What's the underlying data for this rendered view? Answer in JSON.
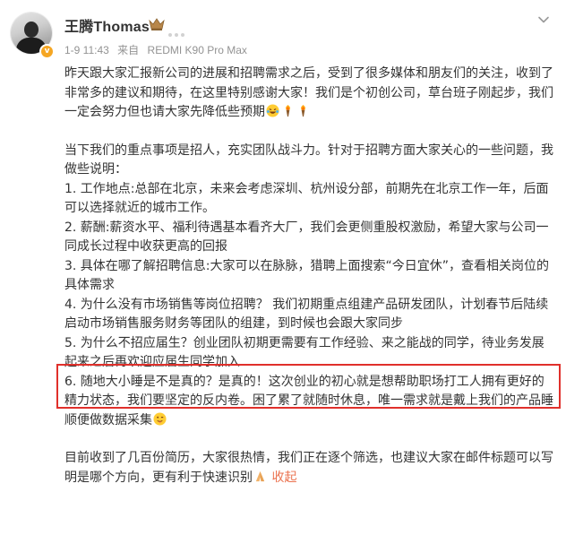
{
  "author": {
    "name": "王腾Thomas",
    "avatar_icon": "avatar-photo",
    "verified_icon": "verified-v-icon",
    "crown_icon": "crown-icon"
  },
  "meta": {
    "date": "1-9 11:43",
    "source_prefix": "来自",
    "device": "REDMI K90 Pro Max"
  },
  "actions": {
    "more_icon": "chevron-down-icon"
  },
  "post": {
    "para1": "昨天跟大家汇报新公司的进展和招聘需求之后，受到了很多媒体和朋友们的关注，收到了非常多的建议和期待，在这里特别感谢大家！我们是个初创公司，草台班子刚起步，我们一定会努力但也请大家先降低些预期",
    "para1_emojis": [
      "laughing-tears-emoji",
      "torch-emoji",
      "torch-emoji"
    ],
    "intro": "当下我们的重点事项是招人，充实团队战斗力。针对于招聘方面大家关心的一些问题，我做些说明：",
    "item1": "1. 工作地点:总部在北京，未来会考虑深圳、杭州设分部，前期先在北京工作一年，后面可以选择就近的城市工作。",
    "item2": "2. 薪酬:薪资水平、福利待遇基本看齐大厂，我们会更侧重股权激励，希望大家与公司一同成长过程中收获更高的回报",
    "item3": "3. 具体在哪了解招聘信息:大家可以在脉脉，猎聘上面搜索“今日宜休”，查看相关岗位的具体需求",
    "item4": "4. 为什么没有市场销售等岗位招聘？ 我们初期重点组建产品研发团队，计划春节后陆续启动市场销售服务财务等团队的组建，到时候也会跟大家同步",
    "item5": "5. 为什么不招应届生？创业团队初期更需要有工作经验、来之能战的同学，待业务发展起来之后再欢迎应届生同学加入",
    "item6": "6. 随地大小睡是不是真的？是真的！这次创业的初心就是想帮助职场打工人拥有更好的精力状态，我们要坚定的反内卷。困了累了就随时休息，唯一需求就是戴上我们的产品睡顺便做数据采集",
    "item6_emoji": "wink-tongue-emoji",
    "closing": "目前收到了几百份简历，大家很热情，我们正在逐个筛选，也建议大家在邮件标题可以写明是哪个方向，更有利于快速识别",
    "closing_emoji": "praying-hands-emoji",
    "collapse_label": "收起"
  },
  "colors": {
    "highlight_border": "#e0302b",
    "link": "#eb7350",
    "meta_text": "#939393",
    "body_text": "#333333"
  }
}
